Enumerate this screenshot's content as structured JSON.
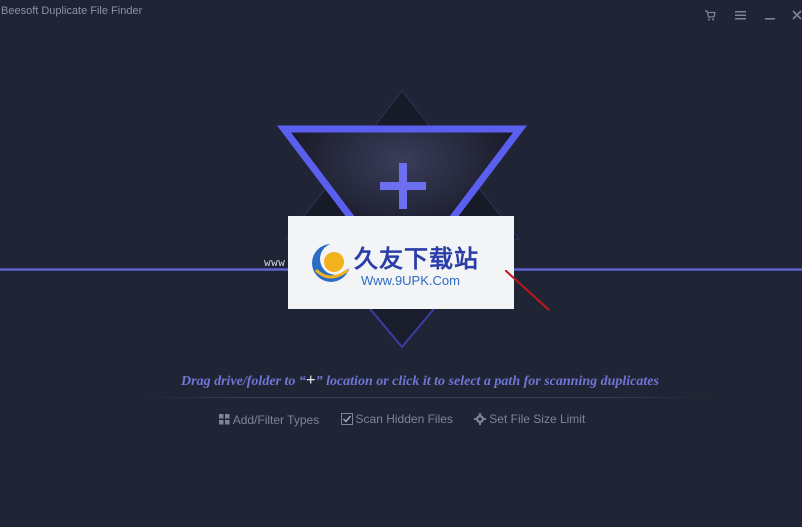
{
  "window": {
    "title": "Beesoft Duplicate File Finder",
    "buttons": [
      "cart-icon",
      "menu-icon",
      "minimize-icon",
      "close-icon"
    ]
  },
  "drop_zone": {
    "icon": "plus-icon",
    "instruction_before": "Drag drive/folder to “",
    "instruction_plus": "+",
    "instruction_after": "” location or click it to select a path for scanning duplicates"
  },
  "options": {
    "add_filter": "Add/Filter Types",
    "scan_hidden": "Scan Hidden Files",
    "size_limit": "Set File Size Limit"
  },
  "watermark": {
    "url": "www.9upk.com",
    "title": "久友下载站",
    "subtitle": "Www.9UPK.Com"
  },
  "colors": {
    "background": "#1f2534",
    "accent": "#6b6fe0",
    "instruction": "#6f76d6"
  }
}
